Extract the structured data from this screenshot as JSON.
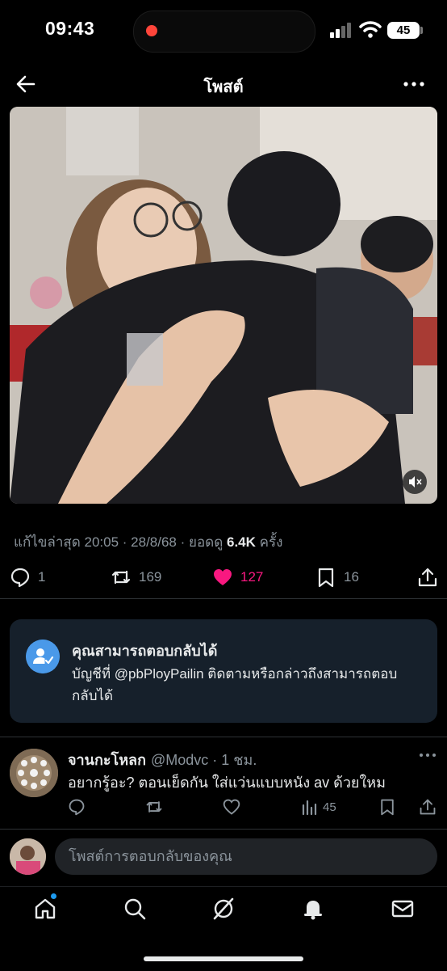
{
  "status": {
    "time": "09:43",
    "battery": "45"
  },
  "header": {
    "title": "โพสต์"
  },
  "meta": {
    "edited": "แก้ไขล่าสุด 20:05 · 28/8/68",
    "views_prefix": " · ยอดดู ",
    "views": "6.4K",
    "views_suffix": " ครั้ง"
  },
  "actions": {
    "replies": "1",
    "reposts": "169",
    "likes": "127",
    "bookmarks": "16"
  },
  "info_card": {
    "title": "คุณสามารถตอบกลับได้",
    "body": "บัญชีที่ @pbPloyPailin ติดตามหรือกล่าวถึงสามารถตอบกลับได้"
  },
  "reply": {
    "name": "จานกะโหลก",
    "handle": "@Modvc · 1 ชม.",
    "text": "อยากรู้อะ? ตอนเย็ดกัน ใส่แว่นแบบหนัง av ด้วยใหม",
    "views": "45"
  },
  "compose": {
    "placeholder": "โพสต์การตอบกลับของคุณ"
  },
  "colors": {
    "like": "#f91880",
    "accent": "#1d9bf0",
    "card_bg": "#16202b",
    "muted": "#8b949c"
  },
  "icons": [
    "back-arrow-icon",
    "more-icon",
    "mute-icon",
    "reply-icon",
    "repost-icon",
    "heart-icon",
    "bookmark-icon",
    "share-icon",
    "home-icon",
    "search-icon",
    "grok-icon",
    "bell-icon",
    "mail-icon"
  ]
}
